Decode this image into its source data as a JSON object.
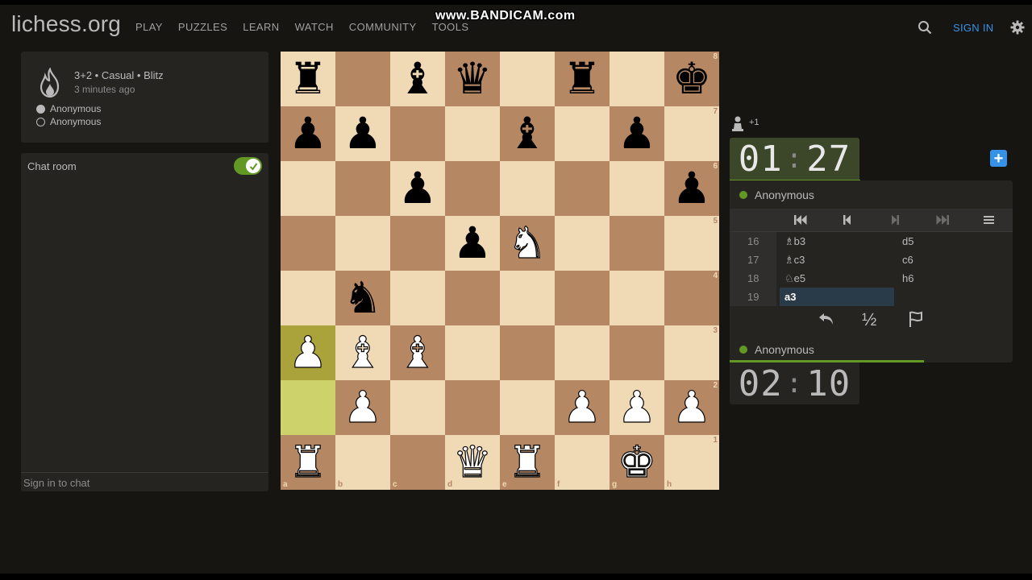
{
  "site": {
    "title": "lichess.org"
  },
  "nav": [
    "PLAY",
    "PUZZLES",
    "LEARN",
    "WATCH",
    "COMMUNITY",
    "TOOLS"
  ],
  "watermark": "www.BANDICAM.com",
  "header": {
    "sign_in": "SIGN IN"
  },
  "game_info": {
    "type": "3+2 • Casual • Blitz",
    "time": "3 minutes ago",
    "white_player": "Anonymous",
    "black_player": "Anonymous"
  },
  "chat": {
    "title": "Chat room",
    "sign_in_prompt": "Sign in to chat",
    "enabled": true
  },
  "board": {
    "light_color": "#f0d9b5",
    "dark_color": "#b58863",
    "highlight_squares": [
      "a3",
      "a2"
    ],
    "ranks_label": [
      "8",
      "7",
      "6",
      "5",
      "4",
      "3",
      "2",
      "1"
    ],
    "files_label": [
      "a",
      "b",
      "c",
      "d",
      "e",
      "f",
      "g",
      "h"
    ],
    "position": [
      [
        "r",
        "",
        "b",
        "q",
        "",
        "r",
        "",
        "k"
      ],
      [
        "p",
        "p",
        "",
        "",
        "b",
        "",
        "p",
        ""
      ],
      [
        "",
        "",
        "p",
        "",
        "",
        "",
        "",
        "p"
      ],
      [
        "",
        "",
        "",
        "p",
        "N",
        "",
        "",
        ""
      ],
      [
        "",
        "n",
        "",
        "",
        "",
        "",
        "",
        ""
      ],
      [
        "P",
        "B",
        "B",
        "",
        "",
        "",
        "",
        ""
      ],
      [
        "",
        "P",
        "",
        "",
        "",
        "P",
        "P",
        "P"
      ],
      [
        "R",
        "",
        "",
        "Q",
        "R",
        "",
        "K",
        ""
      ]
    ]
  },
  "spectators": "+1",
  "clocks": {
    "top": {
      "min": "01",
      "sec": "27"
    },
    "bottom": {
      "min": "02",
      "sec": "10"
    }
  },
  "players": {
    "top": "Anonymous",
    "bottom": "Anonymous"
  },
  "moves": [
    {
      "num": "16",
      "white": "♗b3",
      "black": "d5"
    },
    {
      "num": "17",
      "white": "♗c3",
      "black": "c6"
    },
    {
      "num": "18",
      "white": "♘e5",
      "black": "h6"
    },
    {
      "num": "19",
      "white": "a3",
      "black": ""
    }
  ],
  "active_move": "19",
  "draw_offer": "½",
  "icons": [
    "search-icon",
    "gear-icon",
    "fire-icon",
    "spectator-icon",
    "first-move-icon",
    "prev-move-icon",
    "next-move-icon",
    "last-move-icon",
    "menu-icon",
    "takeback-icon",
    "flag-icon",
    "plus-icon",
    "check-icon"
  ]
}
